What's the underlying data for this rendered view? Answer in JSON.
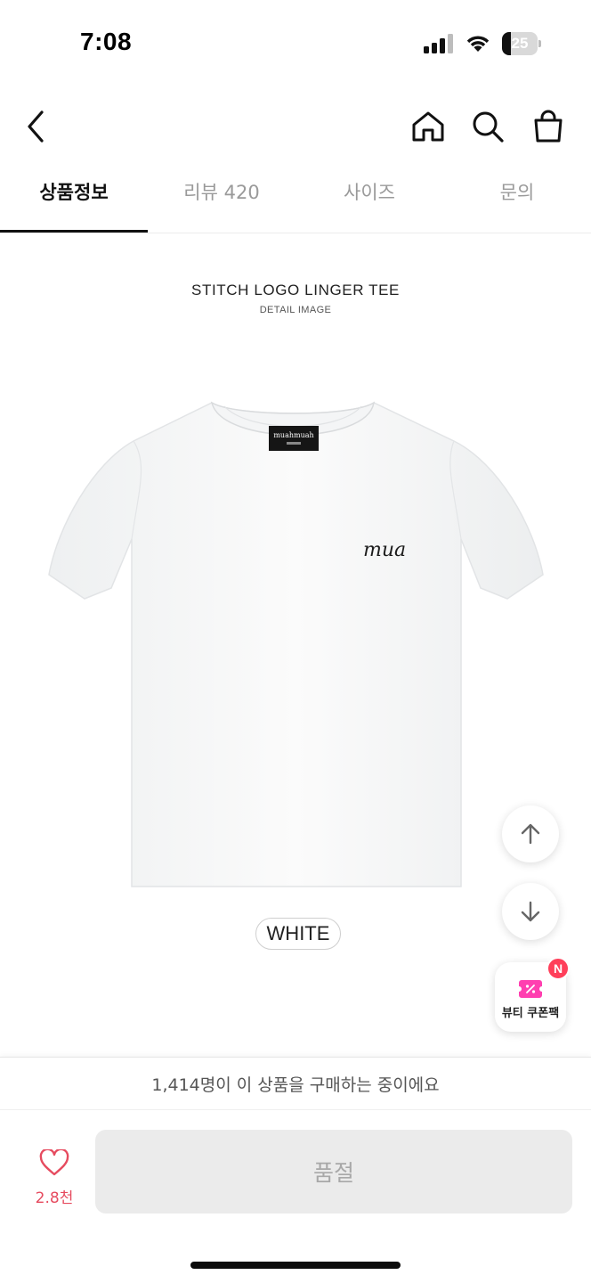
{
  "status_bar": {
    "time": "7:08",
    "battery_level": "25",
    "icons": [
      "cellular-signal-icon",
      "wifi-icon",
      "battery-icon"
    ]
  },
  "nav": {
    "icons": [
      "chevron-left-icon",
      "home-icon",
      "search-icon",
      "shopping-bag-icon"
    ]
  },
  "tabs": [
    {
      "label": "상품정보",
      "active": true
    },
    {
      "label": "리뷰 420",
      "active": false
    },
    {
      "label": "사이즈",
      "active": false
    },
    {
      "label": "문의",
      "active": false
    }
  ],
  "detail": {
    "title": "STITCH LOGO LINGER TEE",
    "subtitle": "DETAIL IMAGE",
    "garment_color": "#ffffff",
    "color_chip": "WHITE",
    "neck_label": "muahmuah",
    "chest_logo": "mua"
  },
  "floating": {
    "icons": [
      "arrow-up-icon",
      "arrow-down-icon",
      "coupon-icon"
    ],
    "coupon_label": "뷰티 쿠폰팩",
    "coupon_badge": "N",
    "coupon_color": "#ff3fb0"
  },
  "bottom": {
    "buying_text": "1,414명이 이 상품을 구매하는 중이에요",
    "like_count": "2.8천",
    "like_color": "#e64b5f",
    "soldout_label": "품절"
  }
}
